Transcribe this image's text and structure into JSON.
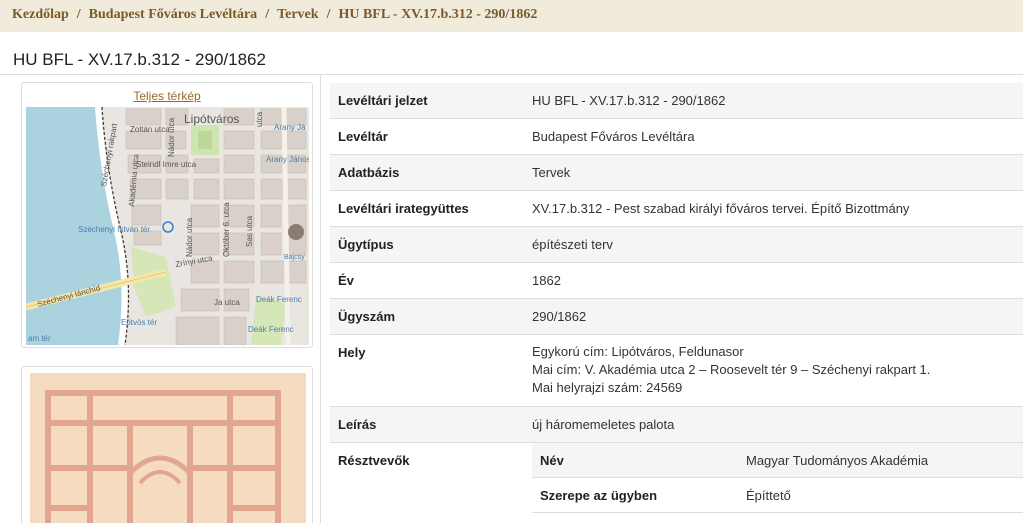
{
  "breadcrumb": {
    "home": "Kezdőlap",
    "archive": "Budapest Főváros Levéltára",
    "plans": "Tervek",
    "current": "HU BFL - XV.17.b.312 - 290/1862"
  },
  "page_title": "HU BFL - XV.17.b.312 - 290/1862",
  "map": {
    "link_label": "Teljes térkép",
    "labels": {
      "lipotvaros": "Lipótváros",
      "zoltan": "Zoltán utca",
      "nador1": "Nádor utca",
      "steindl": "Steindl Imre utca",
      "akademia": "Akadémia utca",
      "szechenyi_rakpart": "Széchenyi rakpart",
      "szechenyi_ter": "Széchenyi István tér",
      "nador2": "Nádor utca",
      "zrinyi": "Zrínyi utca",
      "oktober": "Október 6. utca",
      "sas": "Sas utca",
      "bajcsy": "Bajcsy",
      "arany1": "Arany Já",
      "arany2": "Arany János",
      "lanchid": "Széchenyi lánchíd",
      "eotvos": "Eötvös tér",
      "jo": "Ja utca",
      "deak1": "Deák Ferenc",
      "deak2": "Deák Ferenc",
      "amter": "am tér",
      "utca": "utca"
    }
  },
  "details": [
    {
      "label": "Levéltári jelzet",
      "value": "HU BFL - XV.17.b.312 - 290/1862"
    },
    {
      "label": "Levéltár",
      "value": "Budapest Főváros Levéltára"
    },
    {
      "label": "Adatbázis",
      "value": "Tervek"
    },
    {
      "label": "Levéltári irategyüttes",
      "value": "XV.17.b.312 - Pest szabad királyi főváros tervei. Építő Bizottmány"
    },
    {
      "label": "Ügytípus",
      "value": "építészeti terv"
    },
    {
      "label": "Év",
      "value": "1862"
    },
    {
      "label": "Ügyszám",
      "value": "290/1862"
    }
  ],
  "hely": {
    "label": "Hely",
    "lines": [
      "Egykorú cím: Lipótváros, Feldunasor",
      "Mai cím: V. Akadémia utca 2 – Roosevelt tér 9 – Széchenyi rakpart 1.",
      "Mai helyrajzi szám: 24569"
    ]
  },
  "leiras": {
    "label": "Leírás",
    "value": "új háromemeletes palota"
  },
  "resztvevok": {
    "label": "Résztvevők",
    "rows": [
      {
        "label": "Név",
        "value": "Magyar Tudományos Akadémia"
      },
      {
        "label": "Szerepe az ügyben",
        "value": "Építtető"
      }
    ]
  }
}
